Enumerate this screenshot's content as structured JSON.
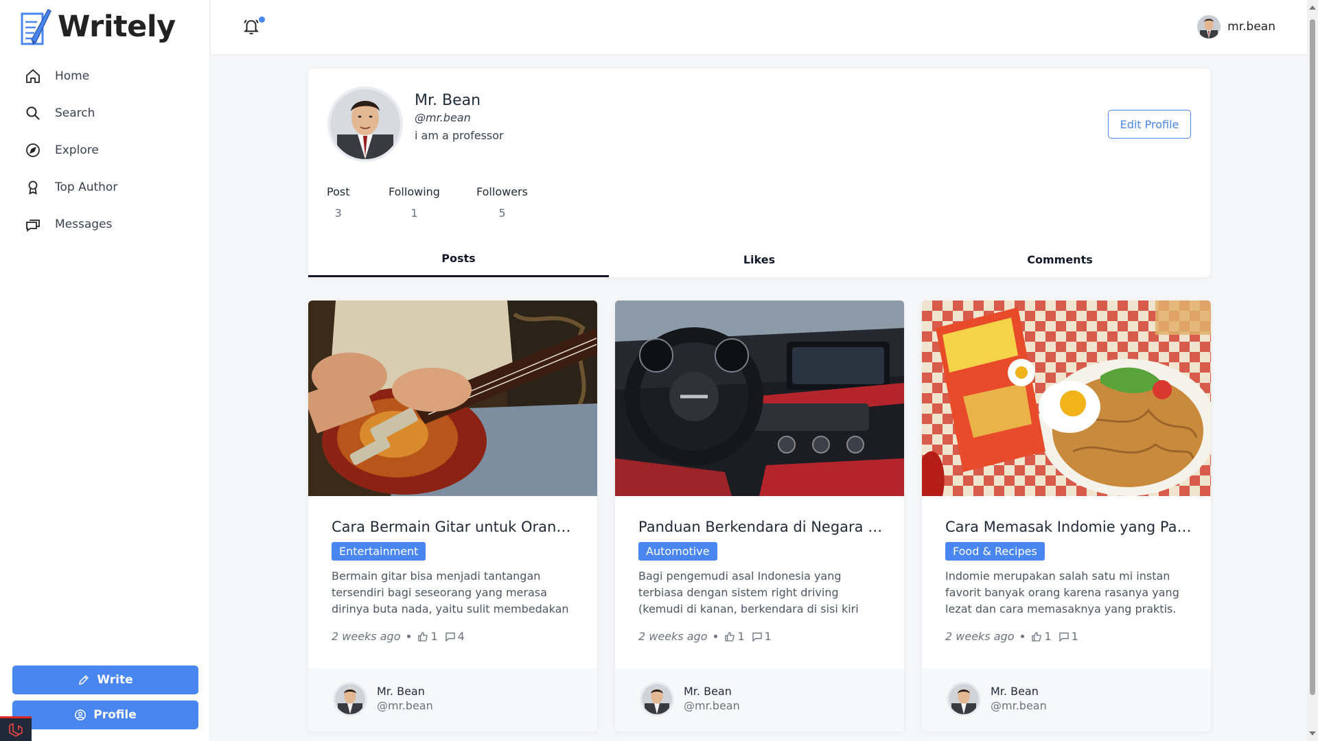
{
  "app": {
    "name": "Writely"
  },
  "sidebar": {
    "items": [
      {
        "label": "Home",
        "icon": "home-icon"
      },
      {
        "label": "Search",
        "icon": "search-icon"
      },
      {
        "label": "Explore",
        "icon": "compass-icon"
      },
      {
        "label": "Top Author",
        "icon": "award-icon"
      },
      {
        "label": "Messages",
        "icon": "messages-icon"
      }
    ],
    "write_label": "Write",
    "profile_label": "Profile"
  },
  "header": {
    "notification_icon": "bell-icon",
    "notification_dot_color": "#4a86f0",
    "username": "mr.bean"
  },
  "profile": {
    "name": "Mr. Bean",
    "handle": "@mr.bean",
    "bio": "i am a professor",
    "edit_label": "Edit Profile",
    "stats": [
      {
        "label": "Post",
        "value": "3"
      },
      {
        "label": "Following",
        "value": "1"
      },
      {
        "label": "Followers",
        "value": "5"
      }
    ]
  },
  "tabs": [
    {
      "label": "Posts",
      "active": true
    },
    {
      "label": "Likes",
      "active": false
    },
    {
      "label": "Comments",
      "active": false
    }
  ],
  "posts": [
    {
      "title": "Cara Bermain Gitar untuk Orang...",
      "tag": "Entertainment",
      "excerpt": "Bermain gitar bisa menjadi tantangan tersendiri bagi seseorang yang merasa dirinya buta nada, yaitu sulit membedakan tinggi...",
      "time": "2 weeks ago",
      "likes": "1",
      "comments": "4",
      "author_name": "Mr. Bean",
      "author_handle": "@mr.bean"
    },
    {
      "title": "Panduan Berkendara di Negara Le...",
      "tag": "Automotive",
      "excerpt": "Bagi pengemudi asal Indonesia yang terbiasa dengan sistem right driving (kemudi di kanan, berkendara di sisi kiri jalan), berkendara di...",
      "time": "2 weeks ago",
      "likes": "1",
      "comments": "1",
      "author_name": "Mr. Bean",
      "author_handle": "@mr.bean"
    },
    {
      "title": "Cara Memasak Indomie yang Palin...",
      "tag": "Food & Recipes",
      "excerpt": "Indomie merupakan salah satu mi instan favorit banyak orang karena rasanya yang lezat dan cara memasaknya yang praktis. Namun, untu...",
      "time": "2 weeks ago",
      "likes": "1",
      "comments": "1",
      "author_name": "Mr. Bean",
      "author_handle": "@mr.bean"
    }
  ],
  "colors": {
    "accent": "#4a86f0",
    "text": "#1f2937",
    "muted": "#6b7280"
  }
}
